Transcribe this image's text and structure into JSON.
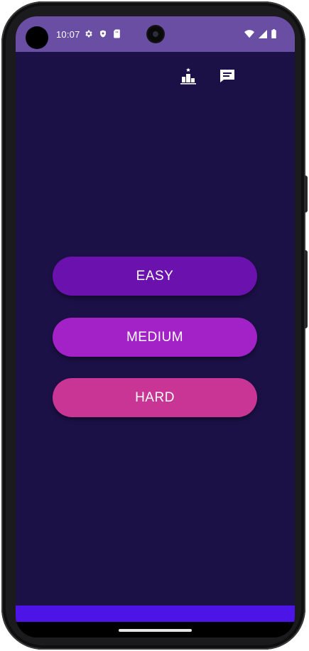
{
  "status_bar": {
    "time": "10:07",
    "left_icons": [
      "settings-icon",
      "shield-icon",
      "sim-card-icon"
    ],
    "right_icons": [
      "wifi-icon",
      "cellular-signal-icon",
      "battery-icon"
    ],
    "background": "#6a4ea3"
  },
  "toolbar": {
    "leaderboard_icon": "leaderboard-icon",
    "chat_icon": "chat-icon"
  },
  "difficulty": {
    "easy_label": "EASY",
    "medium_label": "MEDIUM",
    "hard_label": "HARD",
    "colors": {
      "easy": "#6b12ae",
      "medium": "#a322c8",
      "hard": "#c83594"
    }
  },
  "theme": {
    "background": "#1b1147",
    "bottom_bar": "#4d14e8"
  }
}
